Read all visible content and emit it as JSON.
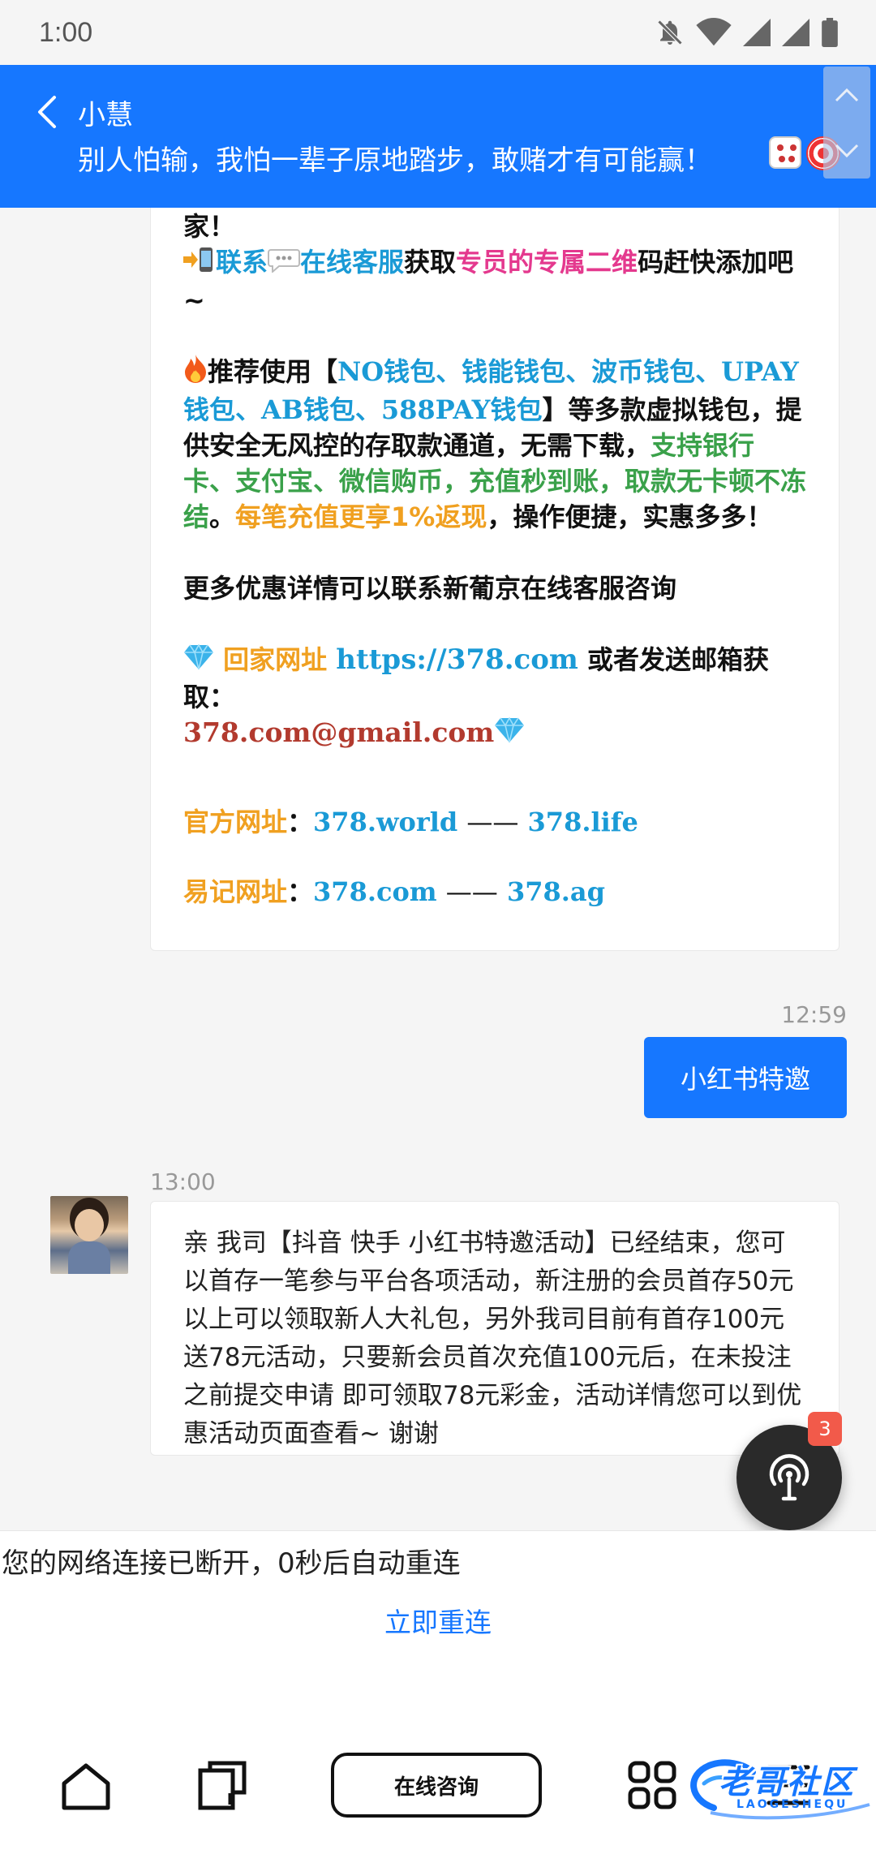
{
  "status_bar": {
    "time": "1:00",
    "icons": [
      "bell-off-icon",
      "wifi-icon",
      "signal-icon",
      "signal-icon",
      "battery-icon"
    ]
  },
  "header": {
    "back_icon": "chevron-left-icon",
    "agent_name": "小慧",
    "slogan": "别人怕输，我怕一辈子原地踏步，敢赌才有可能赢！",
    "emojis": [
      "dice-emoji",
      "target-emoji"
    ],
    "color": "#1677ff"
  },
  "promo": {
    "line_top": "家！",
    "contact_pre": "联系",
    "contact_online": "在线客服",
    "contact_get": "获取",
    "contact_qr": "专员的专属二维",
    "contact_post": "码赶快添加吧~",
    "rec_pre": "推荐使用【",
    "rec_wallets": "NO钱包、钱能钱包、波币钱包、UPAY钱包、AB钱包、588PAY钱包",
    "rec_mid": "】等多款虚拟钱包，提供安全无风控的存取款通道，无需下载，",
    "rec_green": "支持银行卡、支付宝、微信购币，充值秒到账，取款无卡顿不冻结",
    "rec_dot": "。",
    "rec_orange": "每笔充值更享1%返现",
    "rec_end": "，操作便捷，实惠多多！",
    "more": "更多优惠详情可以联系新葡京在线客服咨询",
    "home_label": "回家网址",
    "home_url": "https://378.com",
    "home_mid": "或者发送邮箱获取：",
    "email": "378.com@gmail.com",
    "official_label": "官方网址",
    "official_url1": "378.world",
    "official_dash": "——",
    "official_url2": "378.life",
    "easy_label": "易记网址",
    "easy_url1": "378.com",
    "easy_dash": "——",
    "easy_url2": "378.ag",
    "colon": "："
  },
  "messages": {
    "sent_time": "12:59",
    "sent_text": "小红书特邀",
    "recv_time": "13:00",
    "recv_text": "亲 我司【抖音 快手 小红书特邀活动】已经结束，您可以首存一笔参与平台各项活动，新注册的会员首存50元以上可以领取新人大礼包，另外我司目前有首存100元送78元活动，只要新会员首次充值100元后，在未投注之前提交申请 即可领取78元彩金，活动详情您可以到优惠活动页面查看~ 谢谢"
  },
  "fab": {
    "badge": "3",
    "icon": "headset-signal-icon"
  },
  "network": {
    "message": "您的网络连接已断开，0秒后自动重连",
    "retry": "立即重连"
  },
  "bottom_nav": {
    "consult_label": "在线咨询",
    "watermark_text": "老哥社区",
    "watermark_sub": "LAOGESHEQU"
  }
}
